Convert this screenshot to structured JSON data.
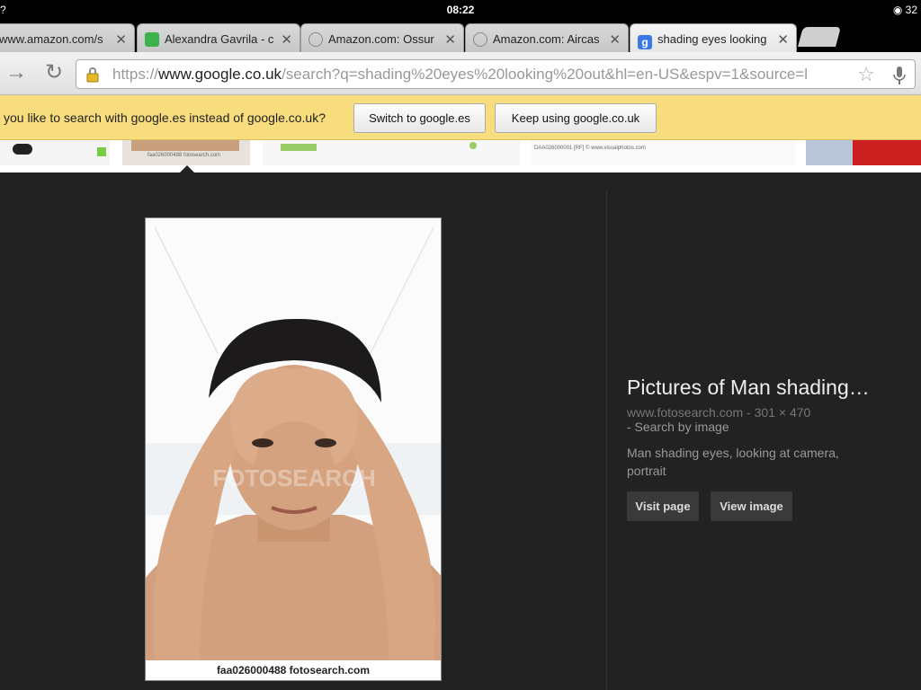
{
  "status_bar": {
    "left": "?",
    "time": "08:22",
    "right": "32"
  },
  "tabs": [
    {
      "title": "www.amazon.com/s",
      "favicon": "globe-icon"
    },
    {
      "title": "Alexandra Gavrila - c",
      "favicon": "green-square-icon"
    },
    {
      "title": "Amazon.com: Ossur",
      "favicon": "globe-icon"
    },
    {
      "title": "Amazon.com: Aircas",
      "favicon": "globe-icon"
    },
    {
      "title": "shading eyes looking",
      "favicon": "google-icon",
      "active": true
    }
  ],
  "toolbar": {
    "url_scheme": "https://",
    "url_host": "www.google.co.uk",
    "url_rest": "/search?q=shading%20eyes%20looking%20out&hl=en-US&espv=1&source=l"
  },
  "infobar": {
    "message": "you like to search with google.es instead of google.co.uk?",
    "switch_label": "Switch to google.es",
    "keep_label": "Keep using google.co.uk"
  },
  "thumbstrip": {
    "captions": [
      "faa026000488 fotosearch.com",
      "DAA026000001 [RF] © www.visualphotos.com"
    ]
  },
  "preview": {
    "watermark": "FOTOSEARCH",
    "caption": "faa026000488  fotosearch.com"
  },
  "details": {
    "title": "Pictures of Man shading…",
    "source": "www.fotosearch.com",
    "separator": " - ",
    "dimensions": "301 × 470",
    "search_by_image": " - Search by image",
    "description": "Man shading eyes, looking at camera, portrait",
    "visit_label": "Visit page",
    "view_label": "View image"
  },
  "colors": {
    "infobar_bg": "#f7dd7e",
    "panel_bg": "#222222",
    "active_tab": "#f0f0f0"
  }
}
